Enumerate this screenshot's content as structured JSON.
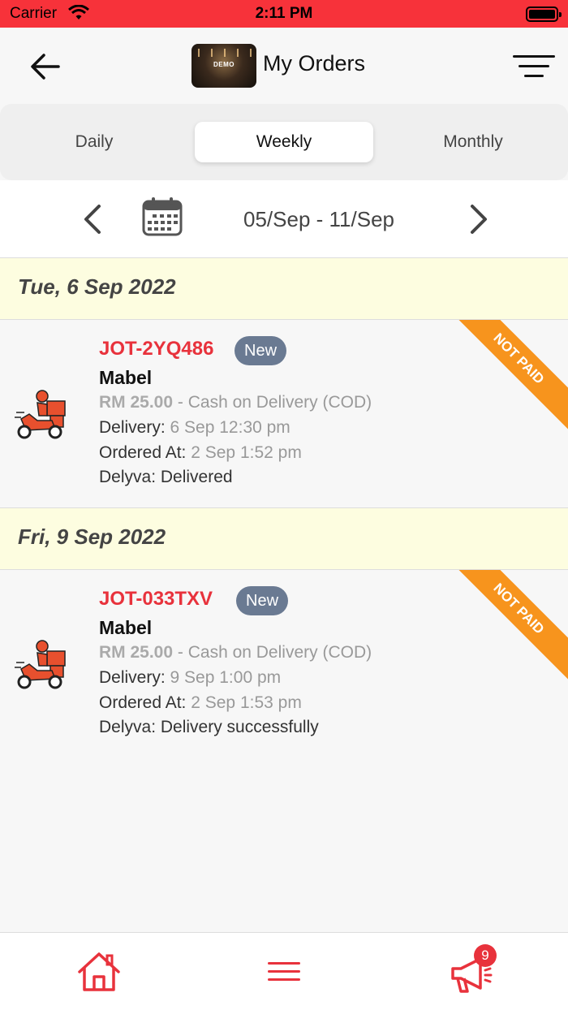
{
  "status_bar": {
    "carrier": "Carrier",
    "time": "2:11 PM"
  },
  "header": {
    "title": "My Orders",
    "logo_text": "DEMO",
    "back_icon": "arrow-left-icon",
    "filter_icon": "filter-icon"
  },
  "tabs": [
    {
      "label": "Daily",
      "selected": false
    },
    {
      "label": "Weekly",
      "selected": true
    },
    {
      "label": "Monthly",
      "selected": false
    }
  ],
  "date_nav": {
    "range": "05/Sep - 11/Sep",
    "prev_icon": "chevron-left-icon",
    "next_icon": "chevron-right-icon",
    "calendar_icon": "calendar-icon"
  },
  "days": [
    {
      "date": "Tue, 6 Sep 2022",
      "orders": [
        {
          "order_no": "JOT-2YQ486",
          "status": "New",
          "customer": "Mabel",
          "amount": "RM 25.00",
          "payment": "- Cash on Delivery (COD)",
          "delivery_label": "Delivery:",
          "delivery_value": "6 Sep 12:30 pm",
          "ordered_label": "Ordered At:",
          "ordered_value": "2 Sep 1:52 pm",
          "courier_label": "Delyva:",
          "courier_value": "Delivered",
          "ribbon": "NOT PAID"
        }
      ]
    },
    {
      "date": "Fri, 9 Sep 2022",
      "orders": [
        {
          "order_no": "JOT-033TXV",
          "status": "New",
          "customer": "Mabel",
          "amount": "RM 25.00",
          "payment": "- Cash on Delivery (COD)",
          "delivery_label": "Delivery:",
          "delivery_value": "9 Sep 1:00 pm",
          "ordered_label": "Ordered At:",
          "ordered_value": "2 Sep 1:53 pm",
          "courier_label": "Delyva:",
          "courier_value": "Delivery successfully",
          "ribbon": "NOT PAID"
        }
      ]
    }
  ],
  "bottom_nav": {
    "home_icon": "home-icon",
    "menu_icon": "menu-icon",
    "promo_icon": "megaphone-icon",
    "promo_badge": "9"
  },
  "colors": {
    "brand_red": "#e8323c",
    "status_bar": "#f7323a",
    "ribbon_orange": "#f7941d",
    "badge_gray": "#6a7a92",
    "day_header_bg": "#fdfde0"
  }
}
